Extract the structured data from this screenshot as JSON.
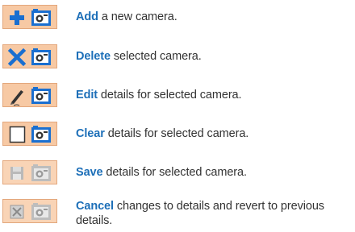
{
  "legend": [
    {
      "id": "add",
      "keyword": "Add",
      "text": " a new camera.",
      "icon": "plus-camera-icon"
    },
    {
      "id": "delete",
      "keyword": "Delete",
      "text": " selected camera.",
      "icon": "x-camera-icon"
    },
    {
      "id": "edit",
      "keyword": "Edit",
      "text": " details for selected camera.",
      "icon": "pencil-camera-icon"
    },
    {
      "id": "clear",
      "keyword": "Clear",
      "text": " details for selected camera.",
      "icon": "blank-camera-icon"
    },
    {
      "id": "save",
      "keyword": "Save",
      "text": " details for selected camera.",
      "icon": "disk-camera-icon"
    },
    {
      "id": "cancel",
      "keyword": "Cancel",
      "text": " changes to details and revert to previous details.",
      "icon": "cancel-camera-icon"
    }
  ],
  "colors": {
    "keyword": "#1d6fb8",
    "button_bg": "#f7c9a4",
    "camera_body": "#1a6fd0"
  }
}
